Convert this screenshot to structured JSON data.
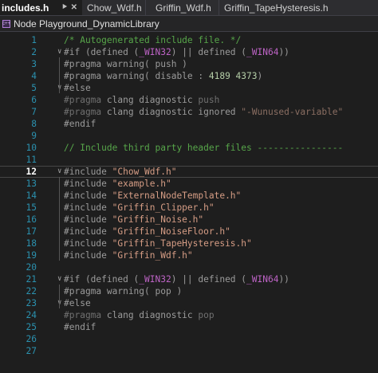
{
  "tabs": [
    {
      "label": "includes.h",
      "active": true
    },
    {
      "label": "Chow_Wdf.h"
    },
    {
      "label": "Griffin_Wdf.h"
    },
    {
      "label": "Griffin_TapeHysteresis.h"
    }
  ],
  "navbar": {
    "project": "Node Playground_DynamicLibrary",
    "icon_text": "c++"
  },
  "lines": [
    {
      "n": "1",
      "tokens": [
        [
          "c-comment",
          "/* Autogenerated include file. */"
        ]
      ]
    },
    {
      "n": "2",
      "fold": true,
      "tokens": [
        [
          "c-pp",
          "#if (defined ("
        ],
        [
          "c-macro",
          "_WIN32"
        ],
        [
          "c-pp",
          ") || defined ("
        ],
        [
          "c-macro",
          "_WIN64"
        ],
        [
          "c-pp",
          "))"
        ]
      ]
    },
    {
      "n": "3",
      "tokens": [
        [
          "c-pp",
          "#pragma warning( push )"
        ]
      ]
    },
    {
      "n": "4",
      "tokens": [
        [
          "c-pp",
          "#pragma warning( disable : "
        ],
        [
          "c-num",
          "4189 4373"
        ],
        [
          "c-pp",
          ")"
        ]
      ]
    },
    {
      "n": "5",
      "fold": true,
      "tokens": [
        [
          "c-pp",
          "#else"
        ]
      ]
    },
    {
      "n": "6",
      "tokens": [
        [
          "c-inactive",
          "#pragma "
        ],
        [
          "c-pp",
          "clang diagnostic "
        ],
        [
          "c-inactive",
          "push"
        ]
      ]
    },
    {
      "n": "7",
      "tokens": [
        [
          "c-inactive",
          "#pragma "
        ],
        [
          "c-pp",
          "clang diagnostic ignored "
        ],
        [
          "c-inactive-str",
          "\"-Wunused-variable\""
        ]
      ]
    },
    {
      "n": "8",
      "tokens": [
        [
          "c-pp",
          "#endif"
        ]
      ]
    },
    {
      "n": "9",
      "tokens": []
    },
    {
      "n": "10",
      "tokens": [
        [
          "c-comment",
          "// Include third party header files ----------------"
        ]
      ]
    },
    {
      "n": "11",
      "tokens": []
    },
    {
      "n": "12",
      "fold": true,
      "current": true,
      "tokens": [
        [
          "c-pp",
          "#include "
        ],
        [
          "c-string",
          "\"Chow_Wdf.h\""
        ]
      ]
    },
    {
      "n": "13",
      "tokens": [
        [
          "c-pp",
          "#include "
        ],
        [
          "c-string",
          "\"example.h\""
        ]
      ]
    },
    {
      "n": "14",
      "tokens": [
        [
          "c-pp",
          "#include "
        ],
        [
          "c-string",
          "\"ExternalNodeTemplate.h\""
        ]
      ]
    },
    {
      "n": "15",
      "tokens": [
        [
          "c-pp",
          "#include "
        ],
        [
          "c-string",
          "\"Griffin_Clipper.h\""
        ]
      ]
    },
    {
      "n": "16",
      "tokens": [
        [
          "c-pp",
          "#include "
        ],
        [
          "c-string",
          "\"Griffin_Noise.h\""
        ]
      ]
    },
    {
      "n": "17",
      "tokens": [
        [
          "c-pp",
          "#include "
        ],
        [
          "c-string",
          "\"Griffin_NoiseFloor.h\""
        ]
      ]
    },
    {
      "n": "18",
      "tokens": [
        [
          "c-pp",
          "#include "
        ],
        [
          "c-string",
          "\"Griffin_TapeHysteresis.h\""
        ]
      ]
    },
    {
      "n": "19",
      "tokens": [
        [
          "c-pp",
          "#include "
        ],
        [
          "c-string",
          "\"Griffin_Wdf.h\""
        ]
      ]
    },
    {
      "n": "20",
      "tokens": []
    },
    {
      "n": "21",
      "fold": true,
      "tokens": [
        [
          "c-pp",
          "#if (defined ("
        ],
        [
          "c-macro",
          "_WIN32"
        ],
        [
          "c-pp",
          ") || defined ("
        ],
        [
          "c-macro",
          "_WIN64"
        ],
        [
          "c-pp",
          "))"
        ]
      ]
    },
    {
      "n": "22",
      "tokens": [
        [
          "c-pp",
          "#pragma warning( pop )"
        ]
      ]
    },
    {
      "n": "23",
      "fold": true,
      "tokens": [
        [
          "c-pp",
          "#else"
        ]
      ]
    },
    {
      "n": "24",
      "tokens": [
        [
          "c-inactive",
          "#pragma "
        ],
        [
          "c-pp",
          "clang diagnostic "
        ],
        [
          "c-inactive",
          "pop"
        ]
      ]
    },
    {
      "n": "25",
      "tokens": [
        [
          "c-pp",
          "#endif"
        ]
      ]
    },
    {
      "n": "26",
      "tokens": []
    },
    {
      "n": "27",
      "tokens": []
    }
  ]
}
